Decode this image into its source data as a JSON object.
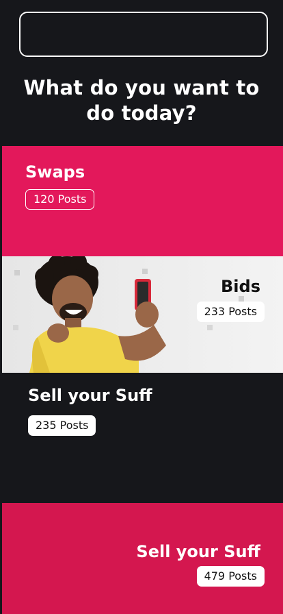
{
  "header": {
    "search_value": "",
    "headline_line1": "What do you want to",
    "headline_line2": "do today?"
  },
  "cards": {
    "swaps": {
      "title": "Swaps",
      "posts": "120 Posts",
      "color": "#e3185b"
    },
    "bids": {
      "title": "Bids",
      "posts": "233 Posts"
    },
    "sell": {
      "title": "Sell your Suff",
      "posts": "235 Posts"
    },
    "sell2": {
      "title": "Sell your Suff",
      "posts": "479 Posts",
      "color": "#d4174f"
    }
  }
}
